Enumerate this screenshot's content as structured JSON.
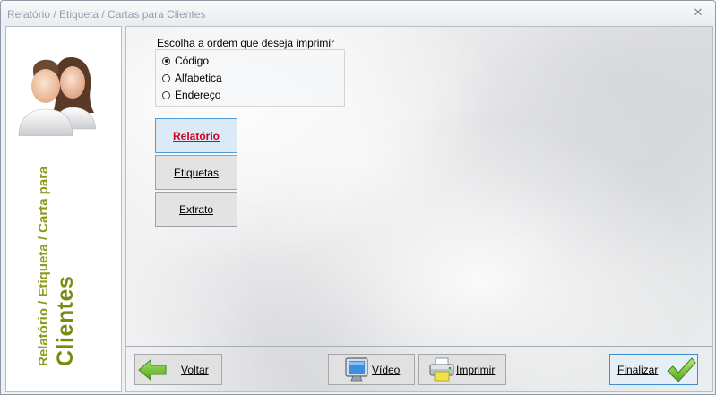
{
  "window": {
    "title": "Relatório / Etiqueta / Cartas para Clientes",
    "close_glyph": "✕"
  },
  "sidebar": {
    "title_line1": "Relatório / Etiqueta / Carta para",
    "title_line2": "Clientes",
    "icon": "users-icon",
    "title_color": "#7d8a12"
  },
  "order": {
    "label": "Escolha a ordem que deseja imprimir",
    "options": [
      {
        "label": "Código",
        "checked": true
      },
      {
        "label": "Alfabetica",
        "checked": false
      },
      {
        "label": "Endereço",
        "checked": false
      }
    ]
  },
  "report_buttons": [
    {
      "label": "Relatório",
      "active": true
    },
    {
      "label": "Etiquetas",
      "active": false
    },
    {
      "label": "Extrato",
      "active": false
    }
  ],
  "footer": {
    "back": {
      "label": "Voltar",
      "icon": "arrow-left-icon"
    },
    "video": {
      "label": "Vídeo",
      "icon": "monitor-icon"
    },
    "print": {
      "label": "Imprimir",
      "icon": "printer-icon"
    },
    "finish": {
      "label": "Finalizar",
      "icon": "checkmark-icon"
    }
  },
  "colors": {
    "accent_active": "#d0021b",
    "active_bg": "#dceaf7",
    "active_border": "#4f9ad8"
  }
}
